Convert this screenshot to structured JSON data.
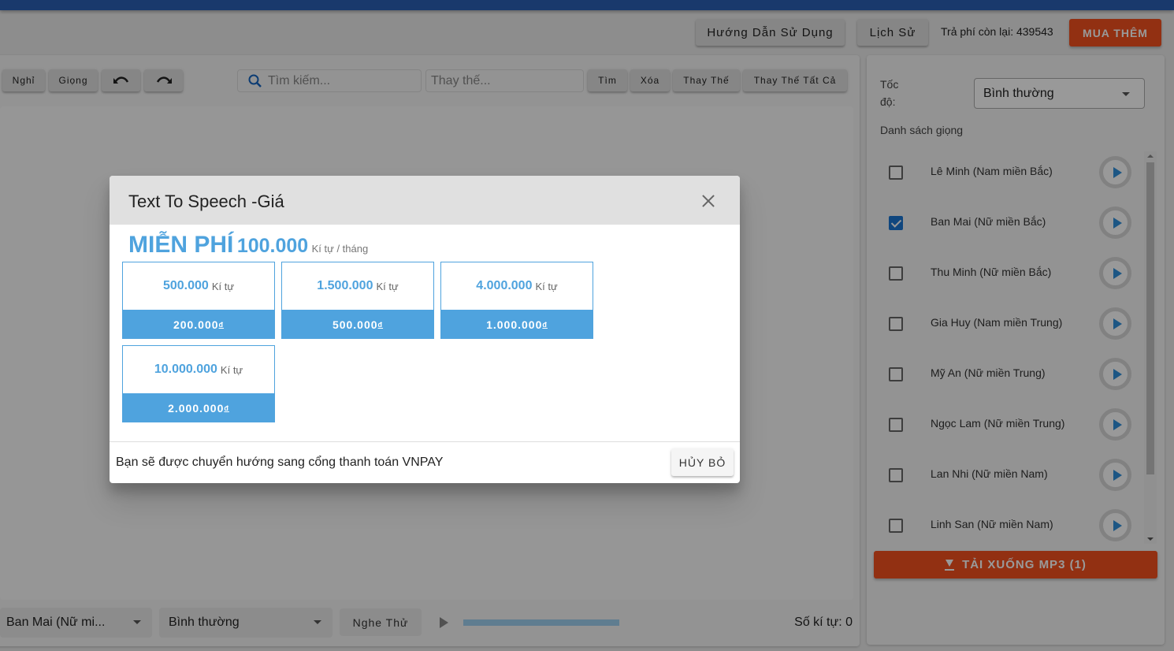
{
  "header": {
    "guide_label": "Hướng Dẫn Sử Dụng",
    "history_label": "Lịch Sử",
    "balance_label": "Trả phí còn lại: 439543",
    "buy_more_label": "MUA THÊM",
    "accent_color": "#f4511e"
  },
  "toolbar": {
    "pause_label": "Nghỉ",
    "voice_label": "Giọng",
    "undo_icon": "undo-icon",
    "redo_icon": "redo-icon",
    "search_placeholder": "Tìm kiếm...",
    "replace_placeholder": "Thay thế...",
    "find_label": "Tìm",
    "delete_label": "Xóa",
    "replace_label": "Thay Thế",
    "replace_all_label": "Thay Thế Tất Cả"
  },
  "bottom_bar": {
    "voice_select_value": "Ban Mai (Nữ mi...",
    "speed_select_value": "Bình thường",
    "preview_label": "Nghe Thử",
    "progress_fraction": 1.0,
    "char_count_label": "Số kí tự: 0"
  },
  "side_panel": {
    "speed_label": "Tốc độ:",
    "speed_value": "Bình thường",
    "voices_label": "Danh sách giọng",
    "voices": [
      {
        "name": "Lê Minh (Nam miền Bắc)",
        "checked": false
      },
      {
        "name": "Ban Mai (Nữ miền Bắc)",
        "checked": true
      },
      {
        "name": "Thu Minh (Nữ miền Bắc)",
        "checked": false
      },
      {
        "name": "Gia Huy (Nam miền Trung)",
        "checked": false
      },
      {
        "name": "Mỹ An (Nữ miền Trung)",
        "checked": false
      },
      {
        "name": "Ngọc Lam (Nữ miền Trung)",
        "checked": false
      },
      {
        "name": "Lan Nhi (Nữ miền Nam)",
        "checked": false
      },
      {
        "name": "Linh San (Nữ miền Nam)",
        "checked": false
      }
    ],
    "download_label": "TẢI XUỐNG MP3 (1)"
  },
  "modal": {
    "title": "Text To Speech -Giá",
    "free_label": "MIỄN PHÍ",
    "free_chars": "100.000",
    "free_unit": "Kí tự / tháng",
    "plans": [
      {
        "chars": "500.000",
        "unit": "Kí tự",
        "price": "200.000",
        "currency": "đ"
      },
      {
        "chars": "1.500.000",
        "unit": "Kí tự",
        "price": "500.000",
        "currency": "đ"
      },
      {
        "chars": "4.000.000",
        "unit": "Kí tự",
        "price": "1.000.000",
        "currency": "đ"
      },
      {
        "chars": "10.000.000",
        "unit": "Kí tự",
        "price": "2.000.000",
        "currency": "đ"
      }
    ],
    "note": "Bạn sẽ được chuyển hướng sang cổng thanh toán VNPAY",
    "cancel_label": "HỦY BỎ",
    "plan_color": "#4fa3de"
  }
}
